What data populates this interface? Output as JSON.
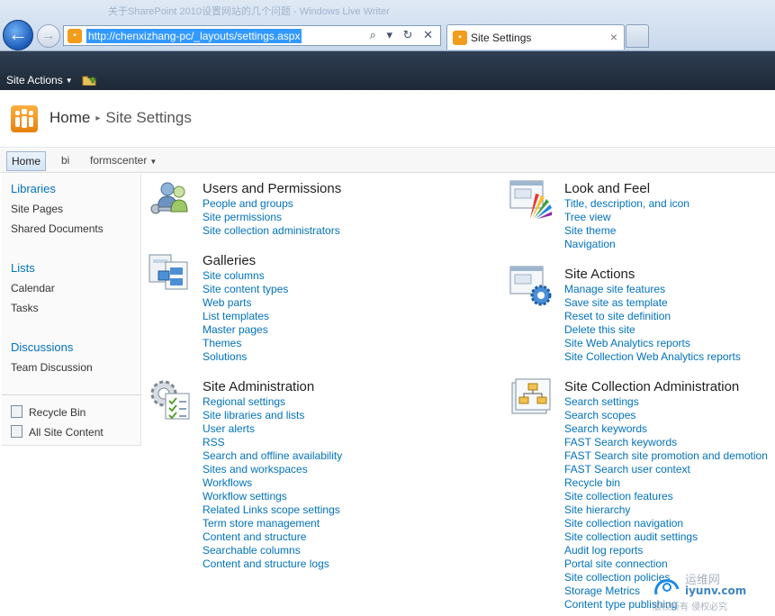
{
  "browser": {
    "window_title": "关于SharePoint 2010设置网站的几个问题 - Windows Live Writer",
    "back_glyph": "←",
    "forward_glyph": "→",
    "address": "http://chenxizhang-pc/_layouts/settings.aspx",
    "address_tools": "⌕ ▾ ↻ ✕",
    "tab_title": "Site Settings",
    "tab_close": "×"
  },
  "ribbon": {
    "site_actions": "Site Actions",
    "caret": "▼"
  },
  "title_area": {
    "home": "Home",
    "separator": "▸",
    "current": "Site Settings"
  },
  "top_nav": {
    "home": "Home",
    "bi": "bi",
    "formscenter": "formscenter",
    "caret": "▼"
  },
  "left_nav": {
    "libraries": "Libraries",
    "site_pages": "Site Pages",
    "shared_documents": "Shared Documents",
    "lists": "Lists",
    "calendar": "Calendar",
    "tasks": "Tasks",
    "discussions": "Discussions",
    "team_discussion": "Team Discussion",
    "recycle_bin": "Recycle Bin",
    "all_site_content": "All Site Content"
  },
  "sections": {
    "users": {
      "title": "Users and Permissions",
      "icon": "users-permissions-icon",
      "links": [
        "People and groups",
        "Site permissions",
        "Site collection administrators"
      ]
    },
    "galleries": {
      "title": "Galleries",
      "icon": "galleries-icon",
      "links": [
        "Site columns",
        "Site content types",
        "Web parts",
        "List templates",
        "Master pages",
        "Themes",
        "Solutions"
      ]
    },
    "siteadmin": {
      "title": "Site Administration",
      "icon": "site-administration-icon",
      "links": [
        "Regional settings",
        "Site libraries and lists",
        "User alerts",
        "RSS",
        "Search and offline availability",
        "Sites and workspaces",
        "Workflows",
        "Workflow settings",
        "Related Links scope settings",
        "Term store management",
        "Content and structure",
        "Searchable columns",
        "Content and structure logs"
      ]
    },
    "look": {
      "title": "Look and Feel",
      "icon": "look-and-feel-icon",
      "links": [
        "Title, description, and icon",
        "Tree view",
        "Site theme",
        "Navigation"
      ]
    },
    "actions": {
      "title": "Site Actions",
      "icon": "site-actions-icon",
      "links": [
        "Manage site features",
        "Save site as template",
        "Reset to site definition",
        "Delete this site",
        "Site Web Analytics reports",
        "Site Collection Web Analytics reports"
      ]
    },
    "sca": {
      "title": "Site Collection Administration",
      "icon": "site-collection-administration-icon",
      "links": [
        "Search settings",
        "Search scopes",
        "Search keywords",
        "FAST Search keywords",
        "FAST Search site promotion and demotion",
        "FAST Search user context",
        "Recycle bin",
        "Site collection features",
        "Site hierarchy",
        "Site collection navigation",
        "Site collection audit settings",
        "Audit log reports",
        "Portal site connection",
        "Site collection policies",
        "Storage Metrics",
        "Content type publishing"
      ]
    }
  },
  "watermark": {
    "line1": "运维网",
    "line2": "iyunv.com",
    "line3": "版权所有 侵权必究"
  }
}
